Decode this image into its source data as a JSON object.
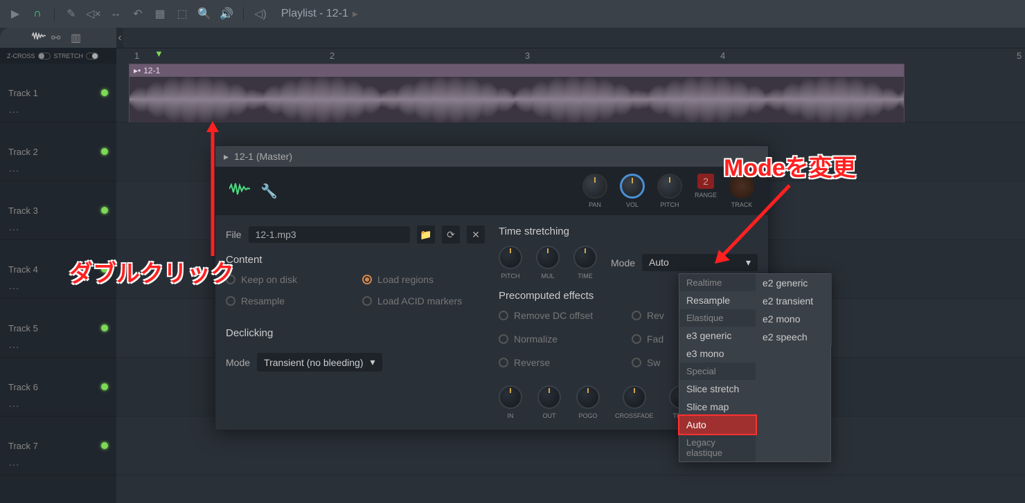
{
  "toolbar": {
    "playlist_label": "Playlist - 12-1"
  },
  "options": {
    "zcross": "Z-CROSS",
    "stretch": "STRETCH"
  },
  "ruler": {
    "m1": "1",
    "m2": "2",
    "m3": "3",
    "m4": "4",
    "m5": "5"
  },
  "tracks": {
    "t1": "Track 1",
    "t2": "Track 2",
    "t3": "Track 3",
    "t4": "Track 4",
    "t5": "Track 5",
    "t6": "Track 6",
    "t7": "Track 7"
  },
  "clip": {
    "name": "12-1"
  },
  "panel": {
    "title": "12-1 (Master)",
    "knob_pan": "PAN",
    "knob_vol": "VOL",
    "knob_pitch": "PITCH",
    "knob_range": "RANGE",
    "range_val": "2",
    "knob_track": "TRACK",
    "file_label": "File",
    "file_name": "12-1.mp3",
    "content_title": "Content",
    "opt_keep": "Keep on disk",
    "opt_resample": "Resample",
    "opt_regions": "Load regions",
    "opt_acid": "Load ACID markers",
    "declick_title": "Declicking",
    "declick_mode_label": "Mode",
    "declick_mode_value": "Transient (no bleeding)",
    "ts_title": "Time stretching",
    "ts_pitch": "PITCH",
    "ts_mul": "MUL",
    "ts_time": "TIME",
    "ts_mode_label": "Mode",
    "ts_mode_value": "Auto",
    "pe_title": "Precomputed effects",
    "pe_dc": "Remove DC offset",
    "pe_rev_pol": "Reverse polarity",
    "pe_norm": "Normalize",
    "pe_fade": "Fade stereo",
    "pe_reverse": "Reverse",
    "pe_swap": "Swap stereo",
    "pe_in": "IN",
    "pe_out": "OUT",
    "pe_pogo": "POGO",
    "pe_crossfade": "CROSSFADE",
    "pe_trim": "TRIM"
  },
  "dropdown": {
    "hdr_realtime": "Realtime",
    "resample": "Resample",
    "hdr_elastique": "Elastique",
    "e3_generic": "e3 generic",
    "e3_mono": "e3 mono",
    "hdr_special": "Special",
    "slice_stretch": "Slice stretch",
    "slice_map": "Slice map",
    "auto": "Auto",
    "hdr_legacy": "Legacy elastique",
    "e2_generic": "e2 generic",
    "e2_transient": "e2 transient",
    "e2_mono": "e2 mono",
    "e2_speech": "e2 speech"
  },
  "annotations": {
    "double_click": "ダブルクリック",
    "mode_change": "Modeを変更"
  }
}
